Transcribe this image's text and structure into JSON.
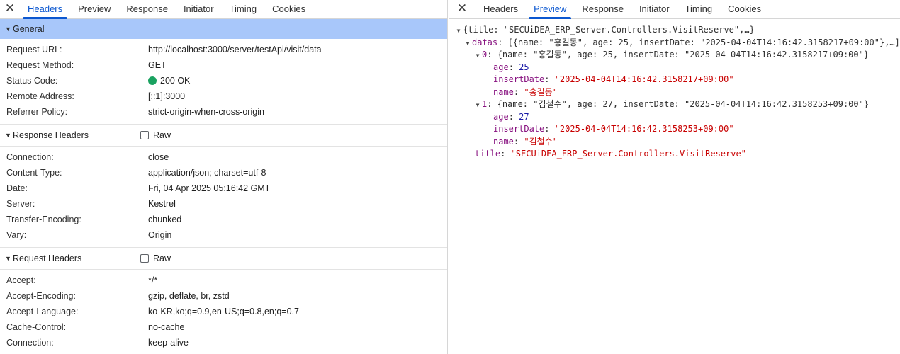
{
  "left_tabs": [
    "Headers",
    "Preview",
    "Response",
    "Initiator",
    "Timing",
    "Cookies"
  ],
  "right_tabs": [
    "Headers",
    "Preview",
    "Response",
    "Initiator",
    "Timing",
    "Cookies"
  ],
  "close_glyph": "✕",
  "general": {
    "title": "General",
    "rows": [
      {
        "key": "Request URL:",
        "value": "http://localhost:3000/server/testApi/visit/data"
      },
      {
        "key": "Request Method:",
        "value": "GET"
      },
      {
        "key": "Status Code:",
        "value": "200 OK"
      },
      {
        "key": "Remote Address:",
        "value": "[::1]:3000"
      },
      {
        "key": "Referrer Policy:",
        "value": "strict-origin-when-cross-origin"
      }
    ]
  },
  "response_headers": {
    "title": "Response Headers",
    "raw_label": "Raw",
    "rows": [
      {
        "key": "Connection:",
        "value": "close"
      },
      {
        "key": "Content-Type:",
        "value": "application/json; charset=utf-8"
      },
      {
        "key": "Date:",
        "value": "Fri, 04 Apr 2025 05:16:42 GMT"
      },
      {
        "key": "Server:",
        "value": "Kestrel"
      },
      {
        "key": "Transfer-Encoding:",
        "value": "chunked"
      },
      {
        "key": "Vary:",
        "value": "Origin"
      }
    ]
  },
  "request_headers": {
    "title": "Request Headers",
    "raw_label": "Raw",
    "rows": [
      {
        "key": "Accept:",
        "value": "*/*"
      },
      {
        "key": "Accept-Encoding:",
        "value": "gzip, deflate, br, zstd"
      },
      {
        "key": "Accept-Language:",
        "value": "ko-KR,ko;q=0.9,en-US;q=0.8,en;q=0.7"
      },
      {
        "key": "Cache-Control:",
        "value": "no-cache"
      },
      {
        "key": "Connection:",
        "value": "keep-alive"
      }
    ]
  },
  "preview": {
    "root_summary": "{title: \"SECUiDEA_ERP_Server.Controllers.VisitReserve\",…}",
    "datas_key": "datas",
    "datas_summary": "[{name: \"홍길동\", age: 25, insertDate: \"2025-04-04T14:16:42.3158217+09:00\"},…]",
    "items": [
      {
        "index": "0",
        "summary": "{name: \"홍길동\", age: 25, insertDate: \"2025-04-04T14:16:42.3158217+09:00\"}",
        "age": "25",
        "insertDate": "\"2025-04-04T14:16:42.3158217+09:00\"",
        "name": "\"홍길동\""
      },
      {
        "index": "1",
        "summary": "{name: \"김철수\", age: 27, insertDate: \"2025-04-04T14:16:42.3158253+09:00\"}",
        "age": "27",
        "insertDate": "\"2025-04-04T14:16:42.3158253+09:00\"",
        "name": "\"김철수\""
      }
    ],
    "labels": {
      "age": "age",
      "insertDate": "insertDate",
      "name": "name",
      "title": "title"
    },
    "title_value": "\"SECUiDEA_ERP_Server.Controllers.VisitReserve\""
  }
}
